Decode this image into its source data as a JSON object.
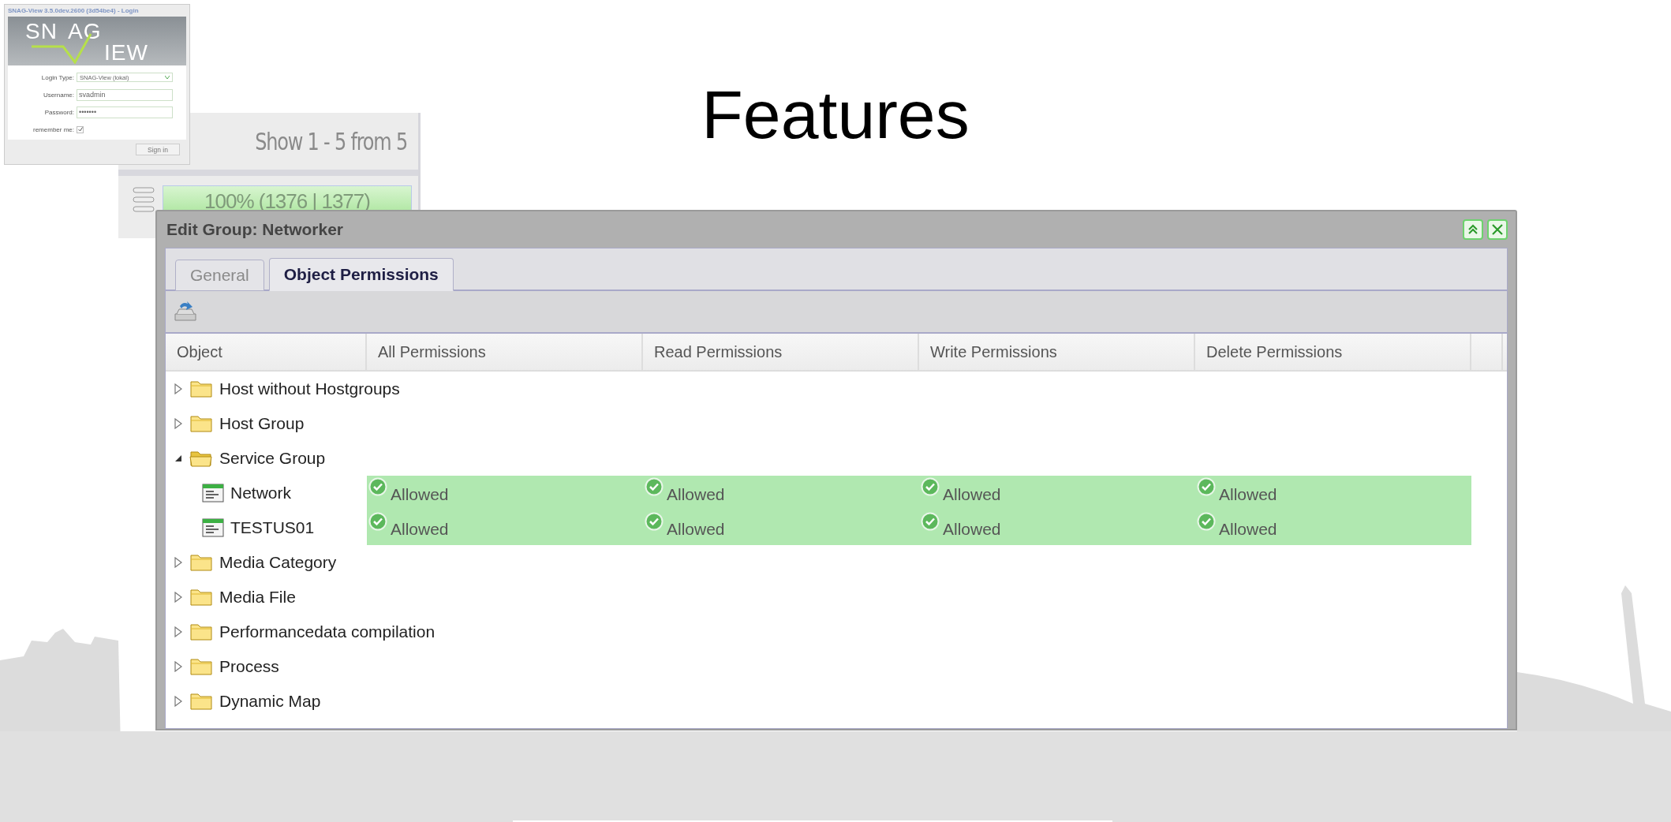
{
  "slide": {
    "title": "Features"
  },
  "login_window": {
    "title": "SNAG-View 3.5.0dev.2600 (3d54be4) - Login",
    "logo": [
      "SN",
      "AG",
      "IEW"
    ],
    "fields": [
      {
        "label": "Login Type:",
        "value": "SNAG-View (lokal)",
        "kind": "select"
      },
      {
        "label": "Username:",
        "value": "svadmin",
        "kind": "text"
      },
      {
        "label": "Password:",
        "value": "•••••••",
        "kind": "text"
      }
    ],
    "remember_me": {
      "label": "remember me:",
      "checked": true
    },
    "sign_in": "Sign in"
  },
  "status_panel": {
    "summary": "Show 1 - 5 from 5",
    "progress": {
      "text": "100% (1376 | 1377)",
      "level": 1
    }
  },
  "dialog": {
    "title": "Edit Group: Networker",
    "tabs": [
      {
        "label": "General",
        "selected": false
      },
      {
        "label": "Object Permissions",
        "selected": true
      }
    ],
    "columns": [
      "Object",
      "All Permissions",
      "Read Permissions",
      "Write Permissions",
      "Delete Permissions"
    ],
    "rows": [
      {
        "label": "Host without Hostgroups",
        "kind": "folder",
        "expanded": false
      },
      {
        "label": "Host Group",
        "kind": "folder",
        "expanded": false
      },
      {
        "label": "Service Group",
        "kind": "folder",
        "expanded": true,
        "children": [
          {
            "label": "Network",
            "kind": "service",
            "permissions": [
              {
                "text": "Allowed",
                "allowed": true
              },
              {
                "text": "Allowed",
                "allowed": true
              },
              {
                "text": "Allowed",
                "allowed": true
              },
              {
                "text": "Allowed",
                "allowed": true
              }
            ]
          },
          {
            "label": "TESTUS01",
            "kind": "service",
            "permissions": [
              {
                "text": "Allowed",
                "allowed": true
              },
              {
                "text": "Allowed",
                "allowed": true
              },
              {
                "text": "Allowed",
                "allowed": true
              },
              {
                "text": "Allowed",
                "allowed": true
              }
            ]
          }
        ]
      },
      {
        "label": "Media Category",
        "kind": "folder",
        "expanded": false
      },
      {
        "label": "Media File",
        "kind": "folder",
        "expanded": false
      },
      {
        "label": "Performancedata compilation",
        "kind": "folder",
        "expanded": false
      },
      {
        "label": "Process",
        "kind": "folder",
        "expanded": false
      },
      {
        "label": "Dynamic Map",
        "kind": "folder",
        "expanded": false
      }
    ]
  }
}
